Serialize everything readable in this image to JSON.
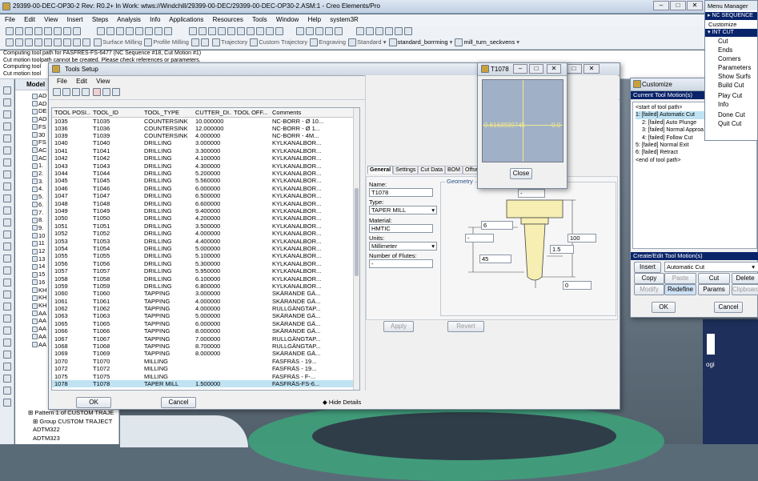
{
  "app": {
    "title": "29399-00-DEC-OP30-2 Rev: R0.2+ In Work: wtws://Windchill/29399-00-DEC/29399-00-DEC-OP30-2.ASM:1 - Creo Elements/Pro",
    "menu": [
      "File",
      "Edit",
      "View",
      "Insert",
      "Steps",
      "Analysis",
      "Info",
      "Applications",
      "Resources",
      "Tools",
      "Window",
      "Help",
      "system3R"
    ],
    "toolbar_texts": {
      "surface_milling": "Surface Milling",
      "profile_milling": "Profile Milling",
      "trajectory": "Trajectory",
      "custom_trajectory": "Custom Trajectory",
      "engraving": "Engraving",
      "standard": "Standard",
      "standard_borrming": "standard_borrming",
      "mill_turn": "mill_turn_seckvens"
    },
    "messages": [
      "Computing tool path for FASFRES-FS-6477 (NC Sequence #18, Cut Motion #1)",
      "Cut motion toolpath cannot be created. Please check references or parameters.",
      "Computing tool",
      "Cut motion tool"
    ]
  },
  "tree": {
    "title": "Model",
    "items": [
      "AD",
      "AD",
      "DE",
      "AD",
      "FS",
      "30",
      "FS",
      "AC",
      "AC",
      "1.",
      "2.",
      "3.",
      "4.",
      "5.",
      "6.",
      "7.",
      "8.",
      "9.",
      "10",
      "11",
      "12",
      "13",
      "14",
      "15",
      "16",
      "KH",
      "KH",
      "KH",
      "AA",
      "AA",
      "AA",
      "AA",
      "AA"
    ],
    "bottom": [
      "Pattern 1 of CUSTOM TRAJE",
      "Group CUSTOM TRAJECT",
      "ADTM322",
      "ADTM323"
    ]
  },
  "tools_setup": {
    "title": "Tools Setup",
    "menu": [
      "File",
      "Edit",
      "View"
    ],
    "columns": [
      "TOOL POSI...",
      "TOOL_ID",
      "TOOL_TYPE",
      "CUTTER_DI...",
      "TOOL OFF...",
      "Comments"
    ],
    "rows": [
      [
        "1035",
        "T1035",
        "COUNTERSINK",
        "10.000000",
        "",
        "NC-BORR - Ø 10..."
      ],
      [
        "1036",
        "T1036",
        "COUNTERSINK",
        "12.000000",
        "",
        "NC-BORR - Ø 1..."
      ],
      [
        "1039",
        "T1039",
        "COUNTERSINK",
        "4.000000",
        "",
        "NC-BORR - 4M..."
      ],
      [
        "1040",
        "T1040",
        "DRILLING",
        "3.000000",
        "",
        "KYLKANALBOR..."
      ],
      [
        "1041",
        "T1041",
        "DRILLING",
        "3.300000",
        "",
        "KYLKANALBOR..."
      ],
      [
        "1042",
        "T1042",
        "DRILLING",
        "4.100000",
        "",
        "KYLKANALBOR..."
      ],
      [
        "1043",
        "T1043",
        "DRILLING",
        "4.300000",
        "",
        "KYLKANALBOR..."
      ],
      [
        "1044",
        "T1044",
        "DRILLING",
        "5.200000",
        "",
        "KYLKANALBOR..."
      ],
      [
        "1045",
        "T1045",
        "DRILLING",
        "5.560000",
        "",
        "KYLKANALBOR..."
      ],
      [
        "1046",
        "T1046",
        "DRILLING",
        "6.000000",
        "",
        "KYLKANALBOR..."
      ],
      [
        "1047",
        "T1047",
        "DRILLING",
        "6.500000",
        "",
        "KYLKANALBOR..."
      ],
      [
        "1048",
        "T1048",
        "DRILLING",
        "6.600000",
        "",
        "KYLKANALBOR..."
      ],
      [
        "1049",
        "T1049",
        "DRILLING",
        "9.400000",
        "",
        "KYLKANALBOR..."
      ],
      [
        "1050",
        "T1050",
        "DRILLING",
        "4.200000",
        "",
        "KYLKANALBOR..."
      ],
      [
        "1051",
        "T1051",
        "DRILLING",
        "3.500000",
        "",
        "KYLKANALBOR..."
      ],
      [
        "1052",
        "T1052",
        "DRILLING",
        "4.000000",
        "",
        "KYLKANALBOR..."
      ],
      [
        "1053",
        "T1053",
        "DRILLING",
        "4.400000",
        "",
        "KYLKANALBOR..."
      ],
      [
        "1054",
        "T1054",
        "DRILLING",
        "5.000000",
        "",
        "KYLKANALBOR..."
      ],
      [
        "1055",
        "T1055",
        "DRILLING",
        "5.100000",
        "",
        "KYLKANALBOR..."
      ],
      [
        "1056",
        "T1056",
        "DRILLING",
        "5.300000",
        "",
        "KYLKANALBOR..."
      ],
      [
        "1057",
        "T1057",
        "DRILLING",
        "5.950000",
        "",
        "KYLKANALBOR..."
      ],
      [
        "1058",
        "T1058",
        "DRILLING",
        "6.100000",
        "",
        "KYLKANALBOR..."
      ],
      [
        "1059",
        "T1059",
        "DRILLING",
        "6.800000",
        "",
        "KYLKANALBOR..."
      ],
      [
        "1060",
        "T1060",
        "TAPPING",
        "3.000000",
        "",
        "SKÄRANDE GÄ..."
      ],
      [
        "1061",
        "T1061",
        "TAPPING",
        "4.000000",
        "",
        "SKÄRANDE GÄ..."
      ],
      [
        "1062",
        "T1062",
        "TAPPING",
        "4.000000",
        "",
        "RULLGÄNGTAP..."
      ],
      [
        "1063",
        "T1063",
        "TAPPING",
        "5.000000",
        "",
        "SKÄRANDE GÄ..."
      ],
      [
        "1065",
        "T1065",
        "TAPPING",
        "6.000000",
        "",
        "SKÄRANDE GÄ..."
      ],
      [
        "1066",
        "T1066",
        "TAPPING",
        "8.000000",
        "",
        "SKÄRANDE GÄ..."
      ],
      [
        "1067",
        "T1067",
        "TAPPING",
        "7.000000",
        "",
        "RULLGÄNGTAP..."
      ],
      [
        "1068",
        "T1068",
        "TAPPING",
        "8.700000",
        "",
        "RULLGÄNGTAP..."
      ],
      [
        "1069",
        "T1069",
        "TAPPING",
        "8.000000",
        "",
        "SKÄRANDE GÄ..."
      ],
      [
        "1070",
        "T1070",
        "MILLING",
        "",
        "",
        "FASFRÄS - 19..."
      ],
      [
        "1072",
        "T1072",
        "MILLING",
        "",
        "",
        "FASFRÄS - 19..."
      ],
      [
        "1075",
        "T1075",
        "MILLING",
        "",
        "",
        "FASFRÄS - F-..."
      ],
      [
        "1078",
        "T1078",
        "TAPER MILL",
        "1.500000",
        "",
        "FASFRÄS-FS-6..."
      ]
    ],
    "selected_row": 35,
    "tabs": [
      "General",
      "Settings",
      "Cut Data",
      "BOM",
      "Offset"
    ],
    "name_label": "Name:",
    "name_value": "T1078",
    "type_label": "Type:",
    "type_value": "TAPER MILL",
    "material_label": "Material:",
    "material_value": "HMTIC",
    "units_label": "Units:",
    "units_value": "Millimeter",
    "flutes_label": "Number of Flutes:",
    "flutes_value": "-",
    "geometry_label": "Geometry",
    "dims": {
      "top": "-",
      "d6": "6",
      "left": "-",
      "len100": "100",
      "len45": "45",
      "d15": "1.5",
      "r0": "0"
    },
    "apply": "Apply",
    "revert": "Revert",
    "ok": "OK",
    "cancel": "Cancel",
    "hide_details": "Hide Details"
  },
  "preview": {
    "title": "T1078",
    "close": "Close",
    "dim_text": "0.6163939745",
    "right_text": "0.0"
  },
  "customize": {
    "title": "Customize",
    "current_header": "Current Tool Motion(s)",
    "items": [
      "<start of tool path>",
      "1: [failed] Automatic Cut",
      "2: [failed] Auto Plunge",
      "3: [failed] Normal Approa",
      "4: [failed] Follow Cut",
      "5: [failed] Normal Exit",
      "6: [failed] Retract",
      "<end of tool path>"
    ],
    "selected": 1,
    "create_header": "Create/Edit Tool Motion(s)",
    "insert": "Insert",
    "select_value": "Automatic Cut",
    "copy": "Copy",
    "paste": "Paste",
    "cut": "Cut",
    "delete": "Delete",
    "modify": "Modify",
    "redefine": "Redefine",
    "params": "Params",
    "clipboard": "Clipboard",
    "ok": "OK",
    "cancel": "Cancel"
  },
  "menu_manager": {
    "title": "Menu Manager",
    "nc_sequence": "NC SEQUENCE",
    "customize": "Customize",
    "int_cut": "INT CUT",
    "items": [
      "Cut",
      "Ends",
      "Corners",
      "Parameters",
      "Show Surfs",
      "Build Cut",
      "Play Cut",
      "Info",
      "Done Cut",
      "Quit Cut"
    ]
  },
  "background": {
    "right_text": "ogi"
  },
  "colors": {
    "accent": "#0a246a",
    "selected_row": "#bfe3f3",
    "tool_tip": "#f6e9a0"
  }
}
